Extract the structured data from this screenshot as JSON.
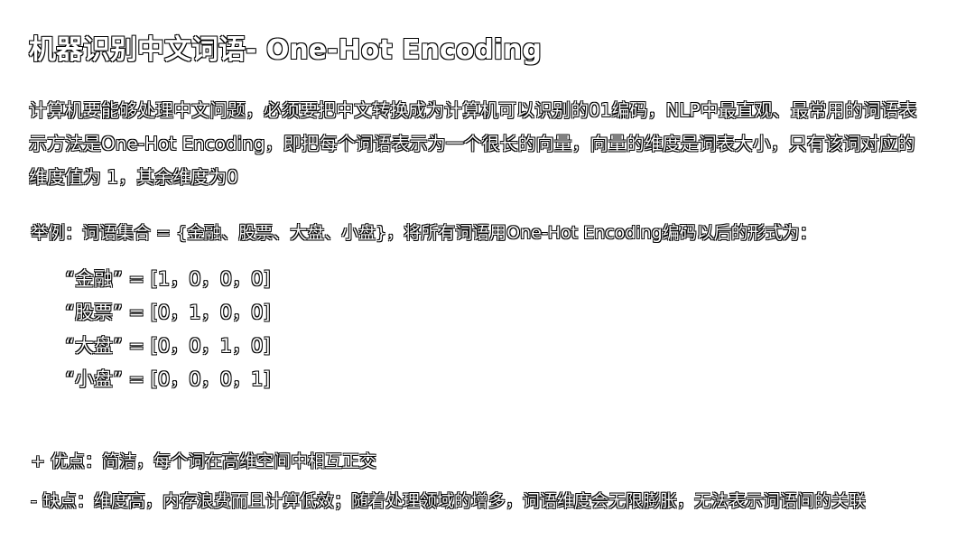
{
  "title": "机器识别中文词语- One-Hot Encoding",
  "intro": {
    "lines": [
      "计算机要能够处理中文问题，必须要把中文转换成为计算机可以识别的01编码，NLP中最直观、最常用的词语表",
      "示方法是One-Hot Encoding，即把每个词语表示为一个很长的向量，向量的维度是词表大小，只有该词对应的",
      "维度值为 1，其余维度为0"
    ]
  },
  "example": {
    "text": "举例：词语集合 = {金融、股票、大盘、小盘}，将所有词语用One-Hot Encoding编码以后的形式为：",
    "vectors": [
      "“金融” = [1，0，0，0]",
      "“股票” = [0，1，0，0]",
      "“大盘” = [0，0，1，0]",
      "“小盘” = [0，0，0，1]"
    ]
  },
  "pros": "+ 优点：简洁，每个词在高维空间中相互正交",
  "cons": "- 缺点：维度高，内存浪费而且计算低效；随着处理领域的增多，词语维度会无限膨胀，无法表示词语间的关联"
}
